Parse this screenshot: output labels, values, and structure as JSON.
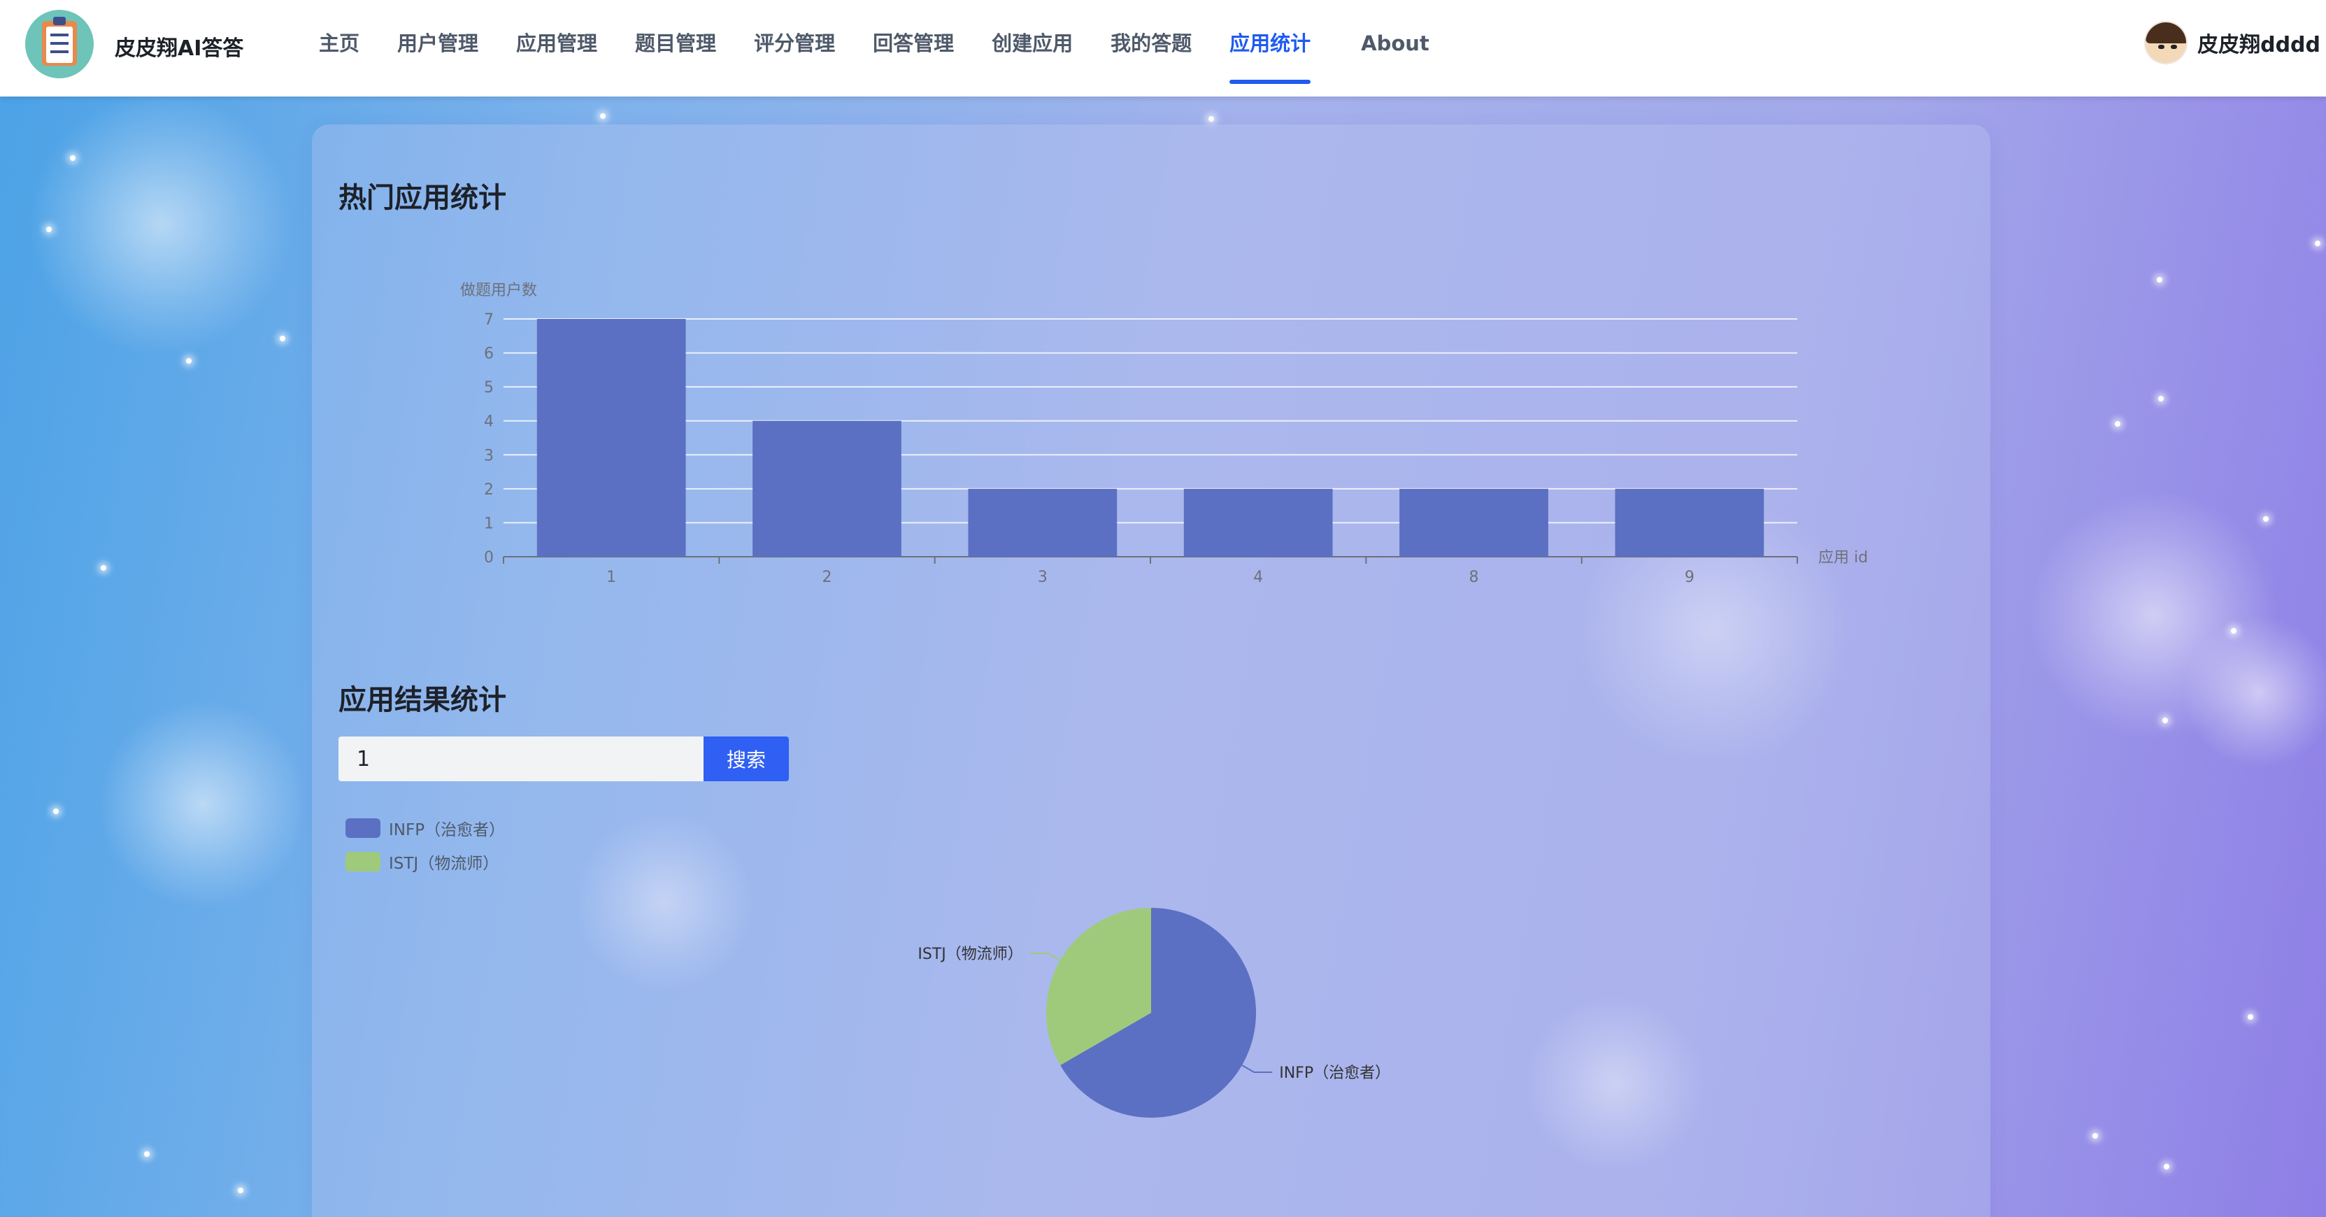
{
  "app": {
    "name": "皮皮翔AI答答"
  },
  "nav": {
    "items": [
      {
        "label": "主页",
        "active": false
      },
      {
        "label": "用户管理",
        "active": false
      },
      {
        "label": "应用管理",
        "active": false
      },
      {
        "label": "题目管理",
        "active": false
      },
      {
        "label": "评分管理",
        "active": false
      },
      {
        "label": "回答管理",
        "active": false
      },
      {
        "label": "创建应用",
        "active": false
      },
      {
        "label": "我的答题",
        "active": false
      },
      {
        "label": "应用统计",
        "active": true
      },
      {
        "label": "About",
        "active": false
      }
    ]
  },
  "user": {
    "name": "皮皮翔dddd"
  },
  "sections": {
    "hot_apps_title": "热门应用统计",
    "result_title": "应用结果统计"
  },
  "search": {
    "value": "1",
    "button_label": "搜索"
  },
  "colors": {
    "accent": "#1f5bf0",
    "bar": "#5b70c2",
    "pie_infp": "#5b70c2",
    "pie_istj": "#9fca7b"
  },
  "chart_data": [
    {
      "type": "bar",
      "categories": [
        "1",
        "2",
        "3",
        "4",
        "8",
        "9"
      ],
      "values": [
        7,
        4,
        2,
        2,
        2,
        2
      ],
      "xlabel": "应用 id",
      "ylabel": "做题用户数",
      "ylim": [
        0,
        7
      ],
      "yticks": [
        0,
        1,
        2,
        3,
        4,
        5,
        6,
        7
      ],
      "grid": true
    },
    {
      "type": "pie",
      "legend_position": "top-left",
      "slices": [
        {
          "label": "INFP（治愈者）",
          "value": 2
        },
        {
          "label": "ISTJ（物流师）",
          "value": 1
        }
      ]
    }
  ]
}
